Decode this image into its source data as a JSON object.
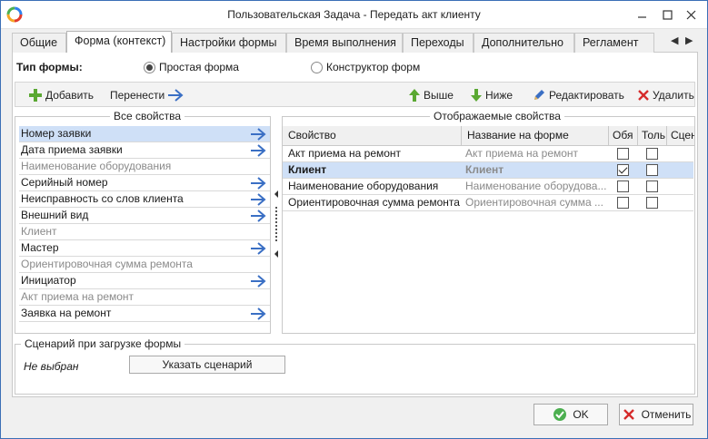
{
  "window": {
    "title": "Пользовательская Задача - Передать акт клиенту",
    "colors": {
      "accent": "#3b6fb6",
      "selection": "#cfe0f7"
    }
  },
  "tabs": [
    {
      "label": "Общие",
      "active": false
    },
    {
      "label": "Форма (контекст)",
      "active": true
    },
    {
      "label": "Настройки формы",
      "active": false
    },
    {
      "label": "Время выполнения",
      "active": false
    },
    {
      "label": "Переходы",
      "active": false
    },
    {
      "label": "Дополнительно",
      "active": false
    },
    {
      "label": "Регламент",
      "active": false
    }
  ],
  "form_type": {
    "label": "Тип формы:",
    "options": [
      {
        "label": "Простая форма",
        "selected": true
      },
      {
        "label": "Конструктор форм",
        "selected": false
      }
    ]
  },
  "toolbar": {
    "add": "Добавить",
    "move": "Перенести",
    "up": "Выше",
    "down": "Ниже",
    "edit": "Редактировать",
    "delete": "Удалить"
  },
  "all_props": {
    "title": "Все свойства",
    "items": [
      {
        "label": "Номер заявки",
        "dim": false,
        "arrow": true,
        "selected": true
      },
      {
        "label": "Дата приема заявки",
        "dim": false,
        "arrow": true,
        "selected": false
      },
      {
        "label": "Наименование оборудования",
        "dim": true,
        "arrow": false,
        "selected": false
      },
      {
        "label": "Серийный номер",
        "dim": false,
        "arrow": true,
        "selected": false
      },
      {
        "label": "Неисправность со слов клиента",
        "dim": false,
        "arrow": true,
        "selected": false
      },
      {
        "label": "Внешний вид",
        "dim": false,
        "arrow": true,
        "selected": false
      },
      {
        "label": "Клиент",
        "dim": true,
        "arrow": false,
        "selected": false
      },
      {
        "label": "Мастер",
        "dim": false,
        "arrow": true,
        "selected": false
      },
      {
        "label": "Ориентировочная сумма ремонта",
        "dim": true,
        "arrow": false,
        "selected": false
      },
      {
        "label": "Инициатор",
        "dim": false,
        "arrow": true,
        "selected": false
      },
      {
        "label": "Акт приема на ремонт",
        "dim": true,
        "arrow": false,
        "selected": false
      },
      {
        "label": "Заявка на ремонт",
        "dim": false,
        "arrow": true,
        "selected": false
      }
    ]
  },
  "shown_props": {
    "title": "Отображаемые свойства",
    "columns": [
      "Свойство",
      "Название на форме",
      "Обя",
      "Толь",
      "Сцен"
    ],
    "rows": [
      {
        "property": "Акт приема на ремонт",
        "form_name": "Акт приема на ремонт",
        "required": false,
        "readonly": false,
        "bold": false,
        "selected": false
      },
      {
        "property": "Клиент",
        "form_name": "Клиент",
        "required": true,
        "readonly": false,
        "bold": true,
        "selected": true
      },
      {
        "property": "Наименование оборудования",
        "form_name": "Наименование оборудова...",
        "required": false,
        "readonly": false,
        "bold": false,
        "selected": false
      },
      {
        "property": "Ориентировочная сумма ремонта",
        "form_name": "Ориентировочная сумма ...",
        "required": false,
        "readonly": false,
        "bold": false,
        "selected": false
      }
    ]
  },
  "scenario": {
    "title": "Сценарий при загрузке формы",
    "value": "Не выбран",
    "button": "Указать сценарий"
  },
  "footer": {
    "ok": "OK",
    "cancel": "Отменить"
  }
}
